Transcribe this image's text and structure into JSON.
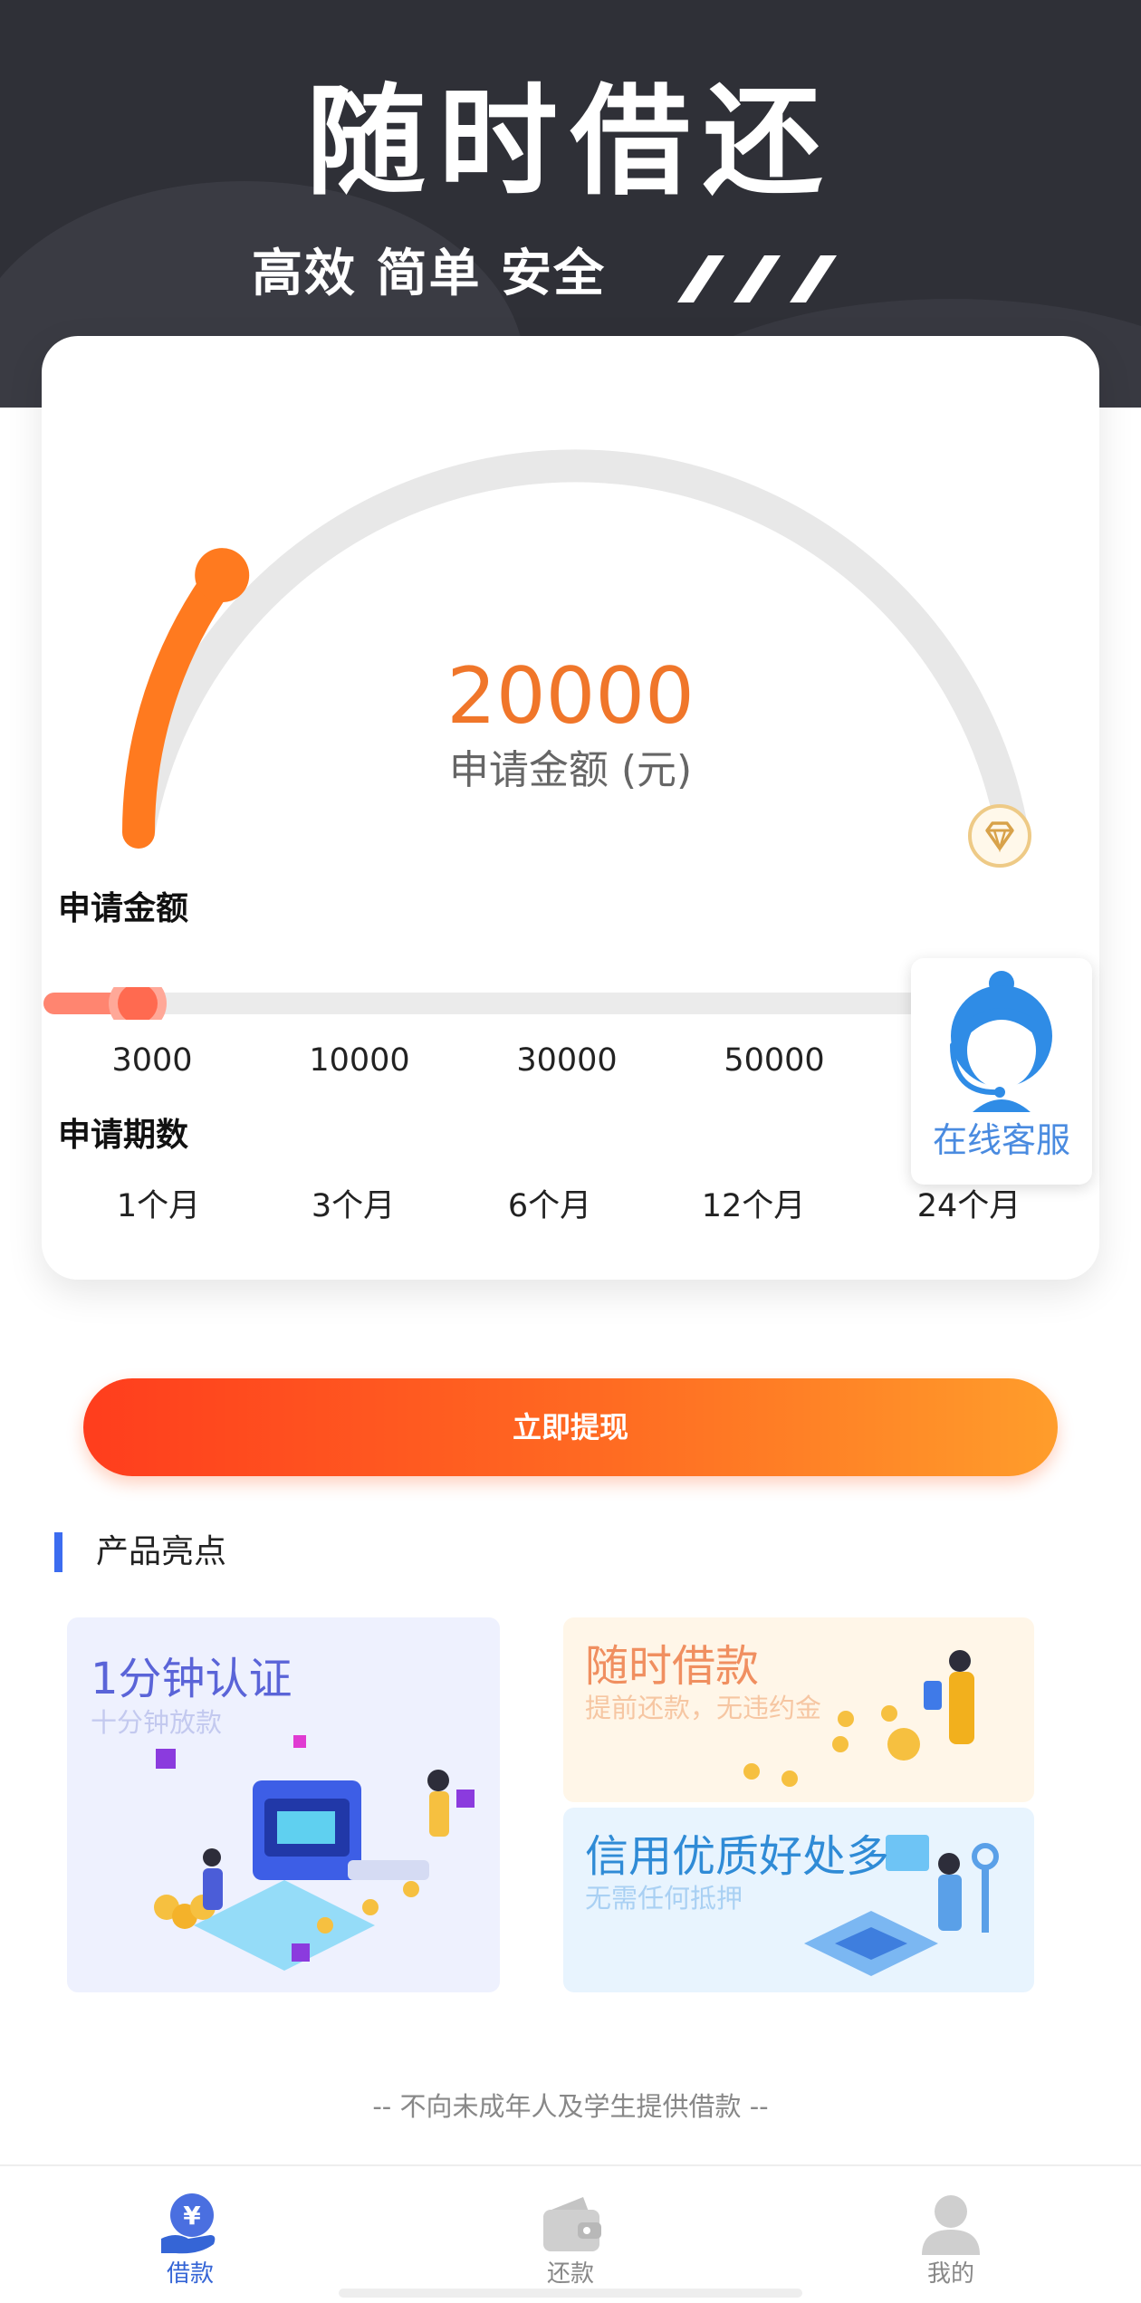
{
  "hero": {
    "title": "随时借还",
    "subtitle": "高效 简单 安全"
  },
  "loan": {
    "amount": "20000",
    "amount_label": "申请金额 (元)",
    "amount_section_label": "申请金额",
    "amount_options": [
      "3000",
      "10000",
      "30000",
      "50000"
    ],
    "slider_level_fraction": 0.1,
    "gauge_level_fraction": 0.2,
    "term_section_label": "申请期数",
    "term_options": [
      "1个月",
      "3个月",
      "6个月",
      "12个月",
      "24个月"
    ]
  },
  "customer_service": {
    "label": "在线客服"
  },
  "withdraw_button": {
    "label": "立即提现"
  },
  "highlights": {
    "title": "产品亮点",
    "tiles": [
      {
        "title": "1分钟认证",
        "subtitle": "十分钟放款"
      },
      {
        "title": "随时借款",
        "subtitle": "提前还款，无违约金"
      },
      {
        "title": "信用优质好处多",
        "subtitle": "无需任何抵押"
      }
    ]
  },
  "footnote": "-- 不向未成年人及学生提供借款 --",
  "tabs": [
    {
      "label": "借款",
      "icon": "loan-icon",
      "active": true
    },
    {
      "label": "还款",
      "icon": "wallet-icon",
      "active": false
    },
    {
      "label": "我的",
      "icon": "profile-icon",
      "active": false
    }
  ],
  "colors": {
    "hero_bg": "#2f3037",
    "accent_orange": "#f0762a",
    "button_gradient": [
      "#ff3d1d",
      "#ff9d2b"
    ],
    "highlight_bar": "#3c6cf0",
    "tab_active": "#3565d6",
    "cs_blue": "#2f8ce6"
  }
}
